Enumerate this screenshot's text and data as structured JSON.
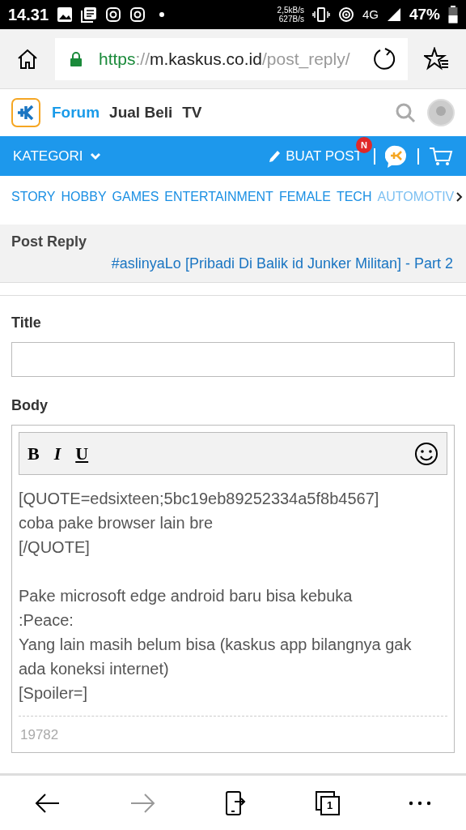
{
  "status_bar": {
    "time": "14.31",
    "speed_down": "2,5kB/s",
    "speed_up": "627B/s",
    "network": "4G",
    "battery": "47%"
  },
  "browser": {
    "scheme": "https",
    "separator": "://",
    "host": "m.kaskus.co.id",
    "path": "/post_reply/"
  },
  "site_nav": [
    {
      "label": "Forum",
      "selected": true
    },
    {
      "label": "Jual Beli",
      "selected": false
    },
    {
      "label": "TV",
      "selected": false
    }
  ],
  "category_bar": {
    "kategori": "KATEGORI",
    "buat_post": "BUAT POST",
    "badge": "N"
  },
  "categories": [
    "STORY",
    "HOBBY",
    "GAMES",
    "ENTERTAINMENT",
    "FEMALE",
    "TECH",
    "AUTOMOTIV"
  ],
  "post_reply": {
    "heading": "Post Reply",
    "thread": "#aslinyaLo [Pribadi Di Balik id Junker Militan] - Part 2"
  },
  "form": {
    "title_label": "Title",
    "body_label": "Body",
    "toolbar": [
      {
        "kind": "bold",
        "label": "B"
      },
      {
        "kind": "italic",
        "label": "I"
      },
      {
        "kind": "underline",
        "label": "U"
      }
    ],
    "body": "[QUOTE=edsixteen;5bc19eb89252334a5f8b4567]\ncoba pake browser lain bre\n[/QUOTE]\n\nPake microsoft edge android baru bisa kebuka\n:Peace:\nYang lain masih belum bisa (kaskus app bilangnya gak ada koneksi internet)\n[Spoiler=]",
    "char_count": "19782"
  },
  "bottom_bar": {
    "forward_disabled": true,
    "tab_count": "1"
  }
}
